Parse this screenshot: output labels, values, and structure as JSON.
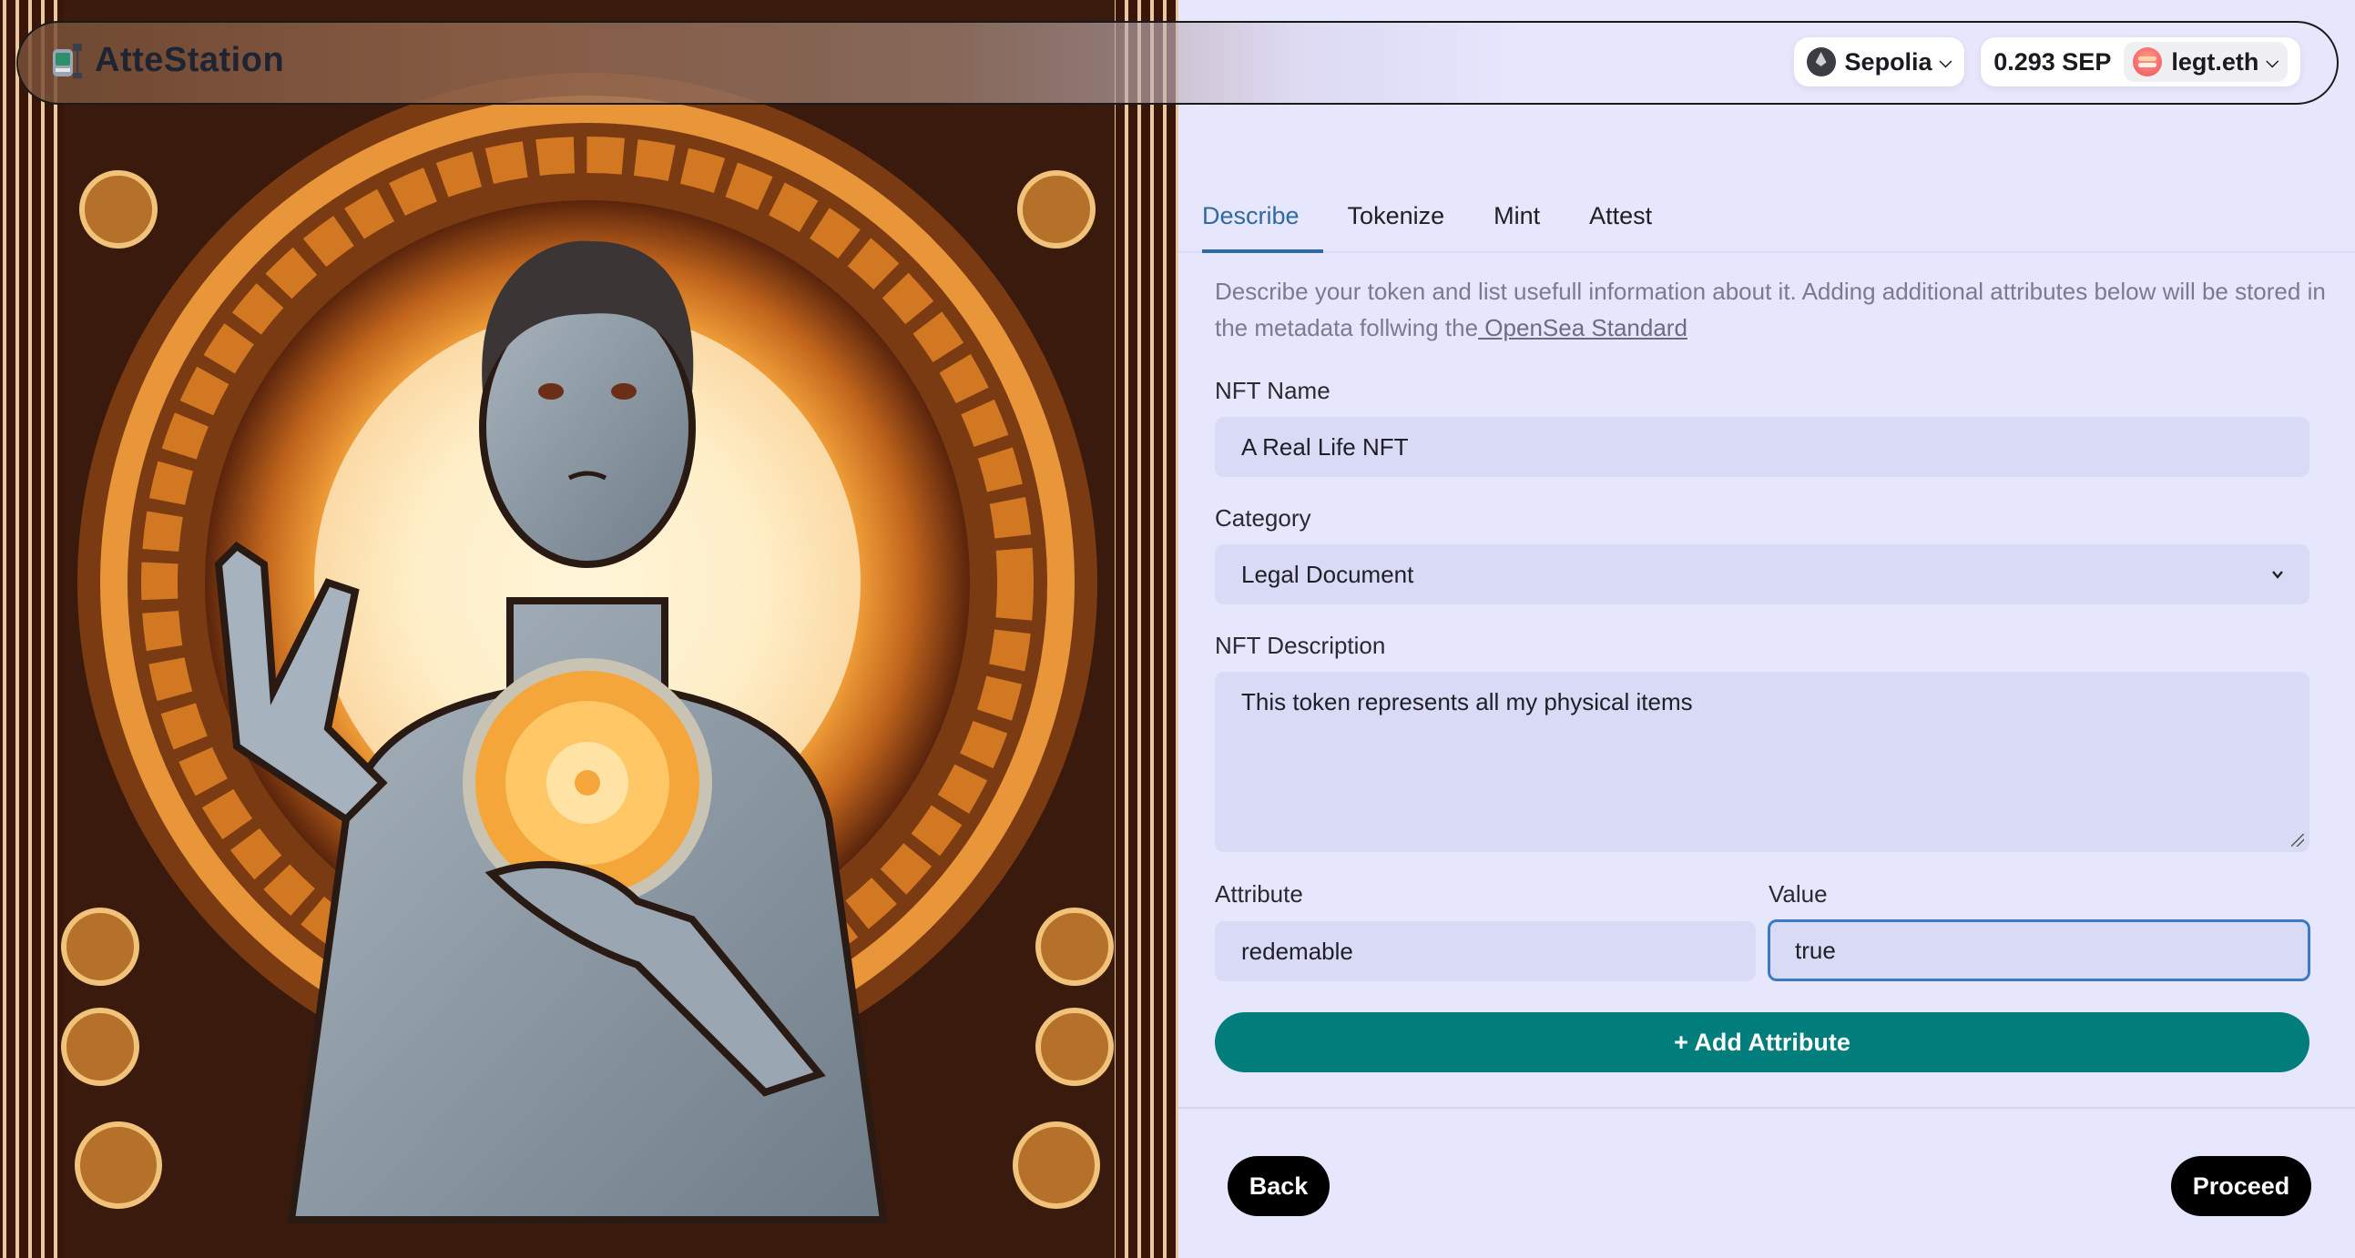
{
  "header": {
    "app_name": "AtteStation",
    "network": "Sepolia",
    "balance": "0.293 SEP",
    "account": "legt.eth"
  },
  "tabs": [
    {
      "label": "Describe",
      "active": true
    },
    {
      "label": "Tokenize",
      "active": false
    },
    {
      "label": "Mint",
      "active": false
    },
    {
      "label": "Attest",
      "active": false
    }
  ],
  "intro": {
    "text": "Describe your token and list usefull information about it. Adding additional attributes below will be stored in the metadata follwing the",
    "link_text": " OpenSea Standard"
  },
  "form": {
    "name_label": "NFT Name",
    "name_value": "A Real Life NFT",
    "category_label": "Category",
    "category_value": "Legal Document",
    "description_label": "NFT Description",
    "description_value": "This token represents all my physical items",
    "attribute_label": "Attribute",
    "attribute_value": "redemable",
    "value_label": "Value",
    "value_value": "true",
    "add_attribute_label": "+ Add Attribute"
  },
  "footer": {
    "back_label": "Back",
    "proceed_label": "Proceed"
  },
  "colors": {
    "accent": "#3169a3",
    "add_button": "#017e7c",
    "background": "#e6e6fd",
    "input_bg": "#d9daf5"
  }
}
